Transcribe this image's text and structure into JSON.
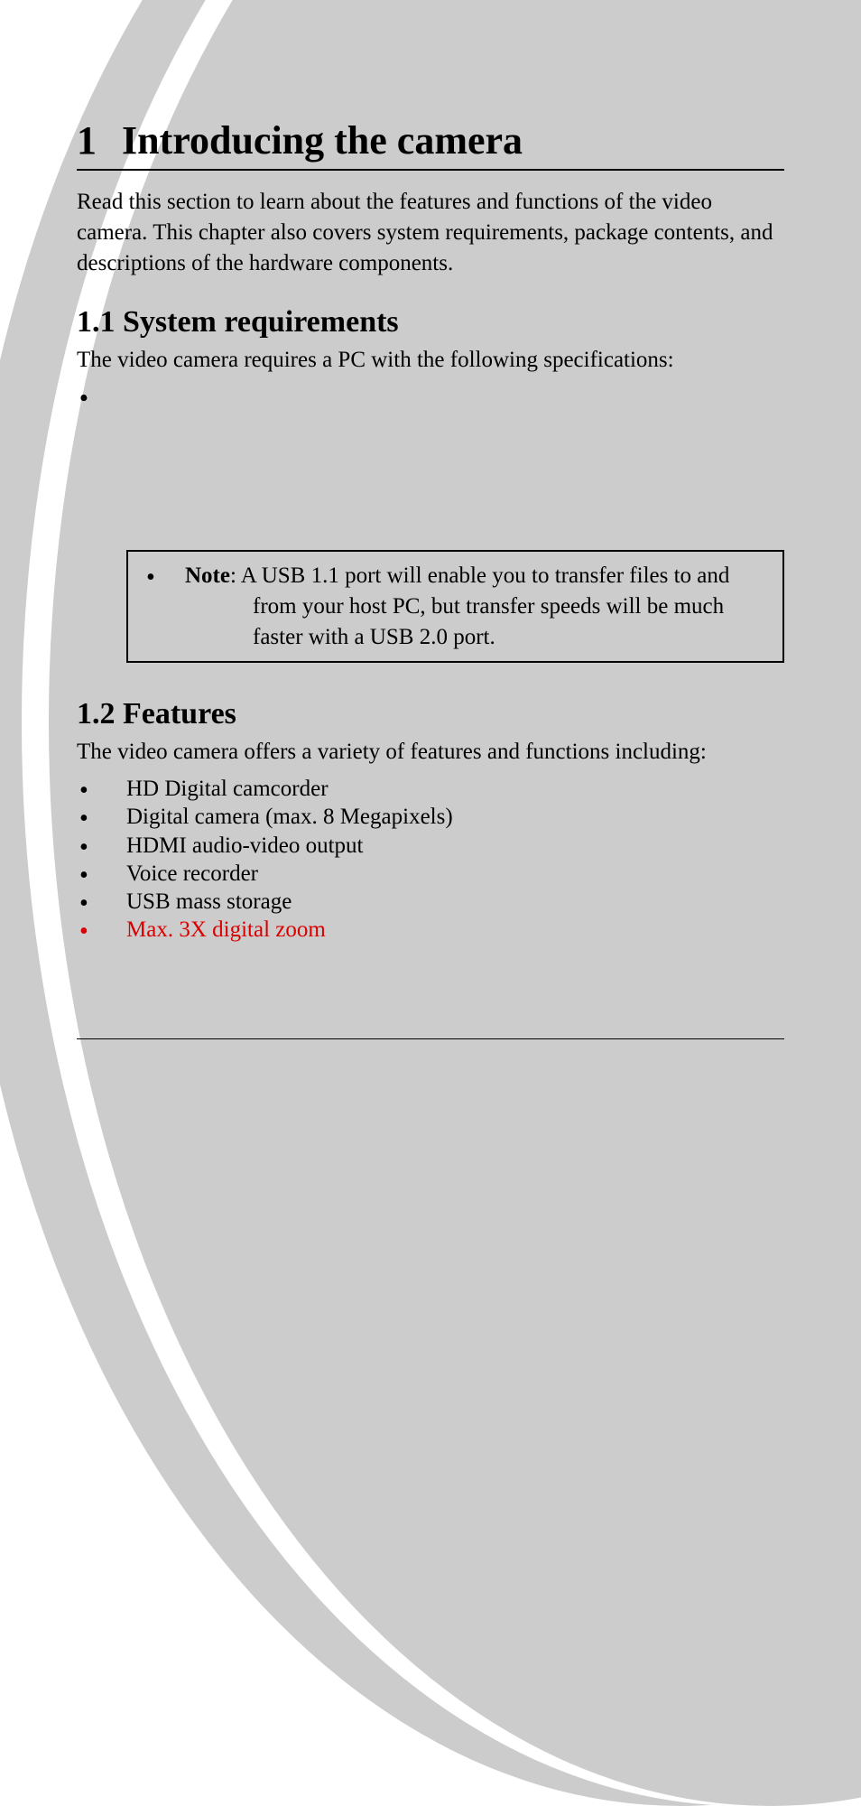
{
  "chapter": {
    "number": "1",
    "title": "Introducing the camera",
    "intro": "Read this section to learn about the features and functions of the video camera. This chapter also covers system requirements, package contents, and descriptions of the hardware components."
  },
  "section_1_1": {
    "heading": "1.1 System requirements",
    "intro": "The video camera requires a PC with the following specifications:",
    "bullets": [
      "",
      "",
      "",
      "",
      ""
    ]
  },
  "note": {
    "label": "Note",
    "text_line1": ": A USB 1.1 port will enable you to transfer files to and",
    "text_line2": "from your host PC, but transfer speeds will be much",
    "text_line3": "faster with a USB 2.0 port."
  },
  "section_1_2": {
    "heading": "1.2 Features",
    "intro": "The video camera offers a variety of features and functions including:",
    "bullets": [
      "HD Digital camcorder",
      "Digital camera (max. 8 Megapixels)",
      "HDMI audio-video output",
      "Voice recorder",
      "USB mass storage",
      "Max. 3X digital zoom"
    ],
    "red_bullet_index": 5
  }
}
